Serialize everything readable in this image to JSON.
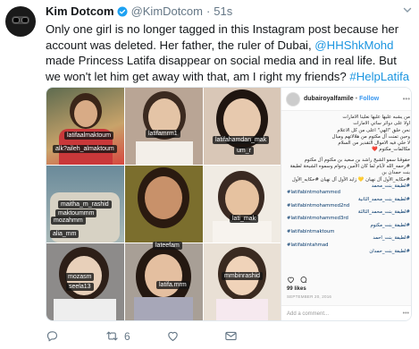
{
  "tweet": {
    "name": "Kim Dotcom",
    "handle": "@KimDotcom",
    "separator": "·",
    "time": "51s",
    "text_part1": "Only one girl is no longer tagged in this Instagram post because her account was deleted. Her father, the ruler of Dubai, ",
    "mention": "@HHShkMohd",
    "text_part2": " made Princess Latifa disappear on social media and in real life. But we won't let him get away with that, am I right my friends? ",
    "hashtag": "#HelpLatifa"
  },
  "photo_tags": [
    "latifaalmaktoum",
    "alk?aileh_almaktoum",
    "latifamrm1",
    "latifahamdan_mak",
    "um_r",
    "maitha_m_rashid",
    "maktoummm",
    "mozahmm",
    "alia_mm",
    "lati_mak",
    "lateefam",
    "mozasm",
    "seela13",
    "latifa.mrm",
    "mmbinrashid"
  ],
  "instagram": {
    "username": "dubairoyalfamile",
    "separator": "•",
    "follow": "Follow",
    "more": "•••",
    "caption_lines": [
      "من يشبه عليها عليها نعلينا الامارات",
      "اولا على دوائر ساتي الامارات",
      "نحن خلق \"الهي\" اعلى من كل الاعلام",
      "وحين تمنت آل مكتوم من هلالاتهم وميال",
      "لا خلي فيه الاموال التقدير من السلام",
      "مكالمات_مكتوم ❤️"
    ],
    "caption_line2": "حقوقنا سمو الشيخ راشد بن سعيد بن مكتوم آل مكتوم",
    "caption_line3": "#رحمه_الله لأيام لما كان الأمين وجوام وسموه الشيخة لطيفة بنت حمدان بن",
    "caption_line4": "#حكايه_الأول آل نهيان 💛 زايد الأول آل نهيان #حكايه_الأول",
    "hashtags": [
      "#لطيفة_بنت_محمد",
      "#latifabintmohammed",
      "#لطيفة_بنت_محمد_الثانية",
      "#latifabintmohammed2nd",
      "#لطيفة_بنت_محمد_الثالثة",
      "#latifabintmohammed3rd",
      "#لطيفة_بنت_مكتوم",
      "#latifabintmaktoum",
      "#لطيفة_بنت_احمد",
      "#latifabintahmad",
      "#لطيفة_بنت_حمدان"
    ],
    "likes": "99 likes",
    "date": "SEPTEMBER 20, 2016",
    "comment_placeholder": "Add a comment...",
    "comment_more": "•••"
  },
  "actions": {
    "reply_count": "",
    "retweet_count": "6",
    "like_count": "",
    "colors": {
      "text": "#657786",
      "link": "#1b95e0"
    }
  }
}
